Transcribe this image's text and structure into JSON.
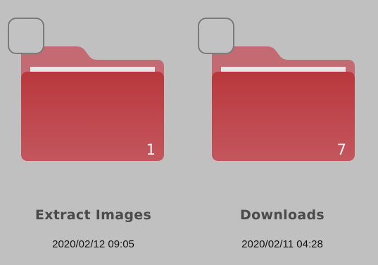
{
  "colors": {
    "background": "#c0c0c0",
    "folder_back": "#c46a73",
    "folder_front_top": "#b8383c",
    "folder_front_bottom": "#c4565e",
    "paper": "#e6e6e6",
    "checkbox_border": "#7a7a7a"
  },
  "folders": [
    {
      "name": "Extract Images",
      "date": "2020/02/12 09:05",
      "count": "1",
      "icon": "folder-icon",
      "selected": false
    },
    {
      "name": "Downloads",
      "date": "2020/02/11 04:28",
      "count": "7",
      "icon": "folder-icon",
      "selected": false
    }
  ]
}
